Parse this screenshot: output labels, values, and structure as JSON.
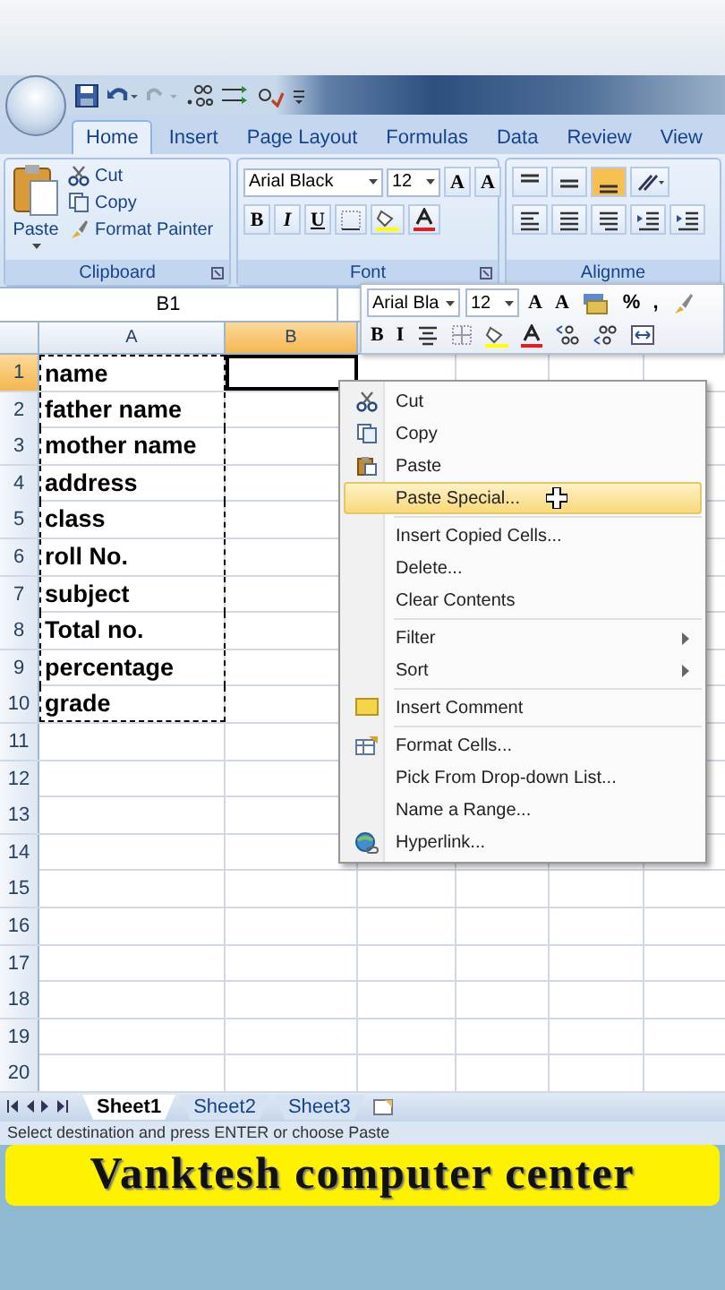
{
  "tabs": [
    {
      "label": "Home",
      "selected": true
    },
    {
      "label": "Insert",
      "selected": false
    },
    {
      "label": "Page Layout",
      "selected": false
    },
    {
      "label": "Formulas",
      "selected": false
    },
    {
      "label": "Data",
      "selected": false
    },
    {
      "label": "Review",
      "selected": false
    },
    {
      "label": "View",
      "selected": false
    }
  ],
  "ribbon": {
    "groups": [
      {
        "kind": "clipboard",
        "label": "Clipboard",
        "paste": "Paste",
        "items": [
          {
            "label": "Cut"
          },
          {
            "label": "Copy"
          },
          {
            "label": "Format Painter"
          }
        ]
      },
      {
        "kind": "font",
        "label": "Font",
        "font": "Arial Black",
        "size": "12",
        "grow": "A",
        "shrink": "A",
        "bold": "B",
        "italic": "I",
        "underline": "U"
      },
      {
        "kind": "alignment",
        "label": "Alignme"
      }
    ]
  },
  "name_box": "B1",
  "columns": [
    {
      "label": "A",
      "selected": false
    },
    {
      "label": "B",
      "selected": true
    }
  ],
  "rows": [
    {
      "number": "1",
      "selected": true,
      "cells": [
        {
          "text": "name",
          "copied": true
        },
        {
          "active": true
        }
      ]
    },
    {
      "number": "2",
      "selected": false,
      "cells": [
        {
          "text": "father name",
          "copied": true
        }
      ]
    },
    {
      "number": "3",
      "selected": false,
      "cells": [
        {
          "text": "mother name",
          "copied": true
        }
      ]
    },
    {
      "number": "4",
      "selected": false,
      "cells": [
        {
          "text": "address",
          "copied": true
        }
      ]
    },
    {
      "number": "5",
      "selected": false,
      "cells": [
        {
          "text": "class",
          "copied": true
        }
      ]
    },
    {
      "number": "6",
      "selected": false,
      "cells": [
        {
          "text": "roll No.",
          "copied": true
        }
      ]
    },
    {
      "number": "7",
      "selected": false,
      "cells": [
        {
          "text": "subject",
          "copied": true
        }
      ]
    },
    {
      "number": "8",
      "selected": false,
      "cells": [
        {
          "text": "Total no.",
          "copied": true
        }
      ]
    },
    {
      "number": "9",
      "selected": false,
      "cells": [
        {
          "text": "percentage",
          "copied": true
        }
      ]
    },
    {
      "number": "10",
      "selected": false,
      "cells": [
        {
          "text": "grade",
          "copied": true
        }
      ]
    },
    {
      "number": "11",
      "selected": false
    },
    {
      "number": "12",
      "selected": false
    },
    {
      "number": "13",
      "selected": false
    },
    {
      "number": "14",
      "selected": false
    },
    {
      "number": "15",
      "selected": false
    },
    {
      "number": "16",
      "selected": false
    },
    {
      "number": "17",
      "selected": false
    },
    {
      "number": "18",
      "selected": false
    },
    {
      "number": "19",
      "selected": false
    },
    {
      "number": "20",
      "selected": false
    }
  ],
  "mini_toolbar": {
    "font": "Arial Bla",
    "size": "12",
    "grow": "A",
    "shrink": "A",
    "percent": "%",
    "comma": ",",
    "bold": "B",
    "italic": "I"
  },
  "context_menu": [
    {
      "label": "Cut",
      "selected": false
    },
    {
      "label": "Copy",
      "selected": false
    },
    {
      "label": "Paste",
      "selected": false
    },
    {
      "label": "Paste Special...",
      "selected": true
    },
    {
      "label": "Insert Copied Cells...",
      "selected": false,
      "separator_before": true
    },
    {
      "label": "Delete...",
      "selected": false
    },
    {
      "label": "Clear Contents",
      "selected": false
    },
    {
      "label": "Filter",
      "selected": false,
      "submenu": true,
      "separator_before": true
    },
    {
      "label": "Sort",
      "selected": false,
      "submenu": true
    },
    {
      "label": "Insert Comment",
      "selected": false,
      "separator_before": true
    },
    {
      "label": "Format Cells...",
      "selected": false,
      "separator_before": true
    },
    {
      "label": "Pick From Drop-down List...",
      "selected": false
    },
    {
      "label": "Name a Range...",
      "selected": false
    },
    {
      "label": "Hyperlink...",
      "selected": false
    }
  ],
  "sheet_tabs": [
    {
      "label": "Sheet1",
      "selected": true
    },
    {
      "label": "Sheet2",
      "selected": false
    },
    {
      "label": "Sheet3",
      "selected": false
    }
  ],
  "status_bar": "Select destination and press ENTER or choose Paste",
  "banner": "Vanktesh computer center"
}
